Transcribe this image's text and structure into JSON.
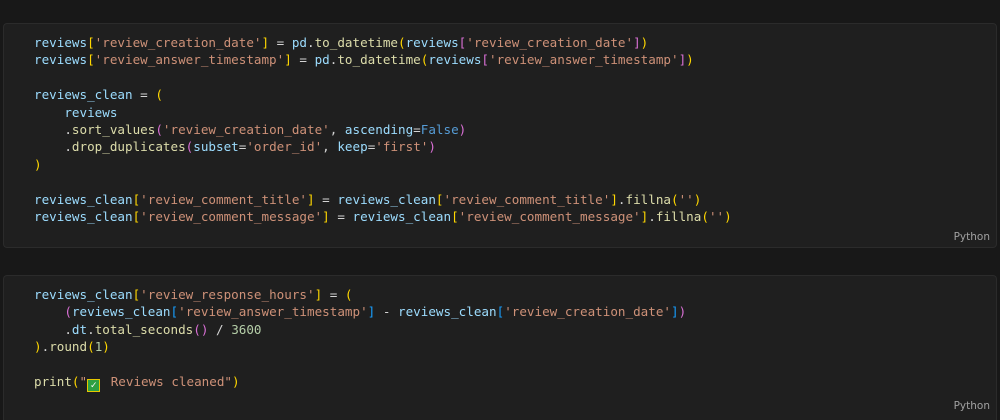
{
  "cells": [
    {
      "language": "Python",
      "lines": [
        [
          [
            "v",
            "reviews"
          ],
          [
            "b1",
            "["
          ],
          [
            "s",
            "'review_creation_date'"
          ],
          [
            "b1",
            "]"
          ],
          [
            "o",
            " = "
          ],
          [
            "v",
            "pd"
          ],
          [
            "o",
            "."
          ],
          [
            "f",
            "to_datetime"
          ],
          [
            "b1",
            "("
          ],
          [
            "v",
            "reviews"
          ],
          [
            "b2",
            "["
          ],
          [
            "s",
            "'review_creation_date'"
          ],
          [
            "b2",
            "]"
          ],
          [
            "b1",
            ")"
          ]
        ],
        [
          [
            "v",
            "reviews"
          ],
          [
            "b1",
            "["
          ],
          [
            "s",
            "'review_answer_timestamp'"
          ],
          [
            "b1",
            "]"
          ],
          [
            "o",
            " = "
          ],
          [
            "v",
            "pd"
          ],
          [
            "o",
            "."
          ],
          [
            "f",
            "to_datetime"
          ],
          [
            "b1",
            "("
          ],
          [
            "v",
            "reviews"
          ],
          [
            "b2",
            "["
          ],
          [
            "s",
            "'review_answer_timestamp'"
          ],
          [
            "b2",
            "]"
          ],
          [
            "b1",
            ")"
          ]
        ],
        [],
        [
          [
            "v",
            "reviews_clean"
          ],
          [
            "o",
            " = "
          ],
          [
            "b1",
            "("
          ]
        ],
        [
          [
            "o",
            "    "
          ],
          [
            "v",
            "reviews"
          ]
        ],
        [
          [
            "o",
            "    ."
          ],
          [
            "f",
            "sort_values"
          ],
          [
            "b2",
            "("
          ],
          [
            "s",
            "'review_creation_date'"
          ],
          [
            "o",
            ", "
          ],
          [
            "v",
            "ascending"
          ],
          [
            "o",
            "="
          ],
          [
            "k",
            "False"
          ],
          [
            "b2",
            ")"
          ]
        ],
        [
          [
            "o",
            "    ."
          ],
          [
            "f",
            "drop_duplicates"
          ],
          [
            "b2",
            "("
          ],
          [
            "v",
            "subset"
          ],
          [
            "o",
            "="
          ],
          [
            "s",
            "'order_id'"
          ],
          [
            "o",
            ", "
          ],
          [
            "v",
            "keep"
          ],
          [
            "o",
            "="
          ],
          [
            "s",
            "'first'"
          ],
          [
            "b2",
            ")"
          ]
        ],
        [
          [
            "b1",
            ")"
          ]
        ],
        [],
        [
          [
            "v",
            "reviews_clean"
          ],
          [
            "b1",
            "["
          ],
          [
            "s",
            "'review_comment_title'"
          ],
          [
            "b1",
            "]"
          ],
          [
            "o",
            " = "
          ],
          [
            "v",
            "reviews_clean"
          ],
          [
            "b1",
            "["
          ],
          [
            "s",
            "'review_comment_title'"
          ],
          [
            "b1",
            "]"
          ],
          [
            "o",
            "."
          ],
          [
            "f",
            "fillna"
          ],
          [
            "b1",
            "("
          ],
          [
            "s",
            "''"
          ],
          [
            "b1",
            ")"
          ]
        ],
        [
          [
            "v",
            "reviews_clean"
          ],
          [
            "b1",
            "["
          ],
          [
            "s",
            "'review_comment_message'"
          ],
          [
            "b1",
            "]"
          ],
          [
            "o",
            " = "
          ],
          [
            "v",
            "reviews_clean"
          ],
          [
            "b1",
            "["
          ],
          [
            "s",
            "'review_comment_message'"
          ],
          [
            "b1",
            "]"
          ],
          [
            "o",
            "."
          ],
          [
            "f",
            "fillna"
          ],
          [
            "b1",
            "("
          ],
          [
            "s",
            "''"
          ],
          [
            "b1",
            ")"
          ]
        ]
      ]
    },
    {
      "language": "Python",
      "lines": [
        [
          [
            "v",
            "reviews_clean"
          ],
          [
            "b1",
            "["
          ],
          [
            "s",
            "'review_response_hours'"
          ],
          [
            "b1",
            "]"
          ],
          [
            "o",
            " = "
          ],
          [
            "b1",
            "("
          ]
        ],
        [
          [
            "o",
            "    "
          ],
          [
            "b2",
            "("
          ],
          [
            "v",
            "reviews_clean"
          ],
          [
            "b3",
            "["
          ],
          [
            "s",
            "'review_answer_timestamp'"
          ],
          [
            "b3",
            "]"
          ],
          [
            "o",
            " - "
          ],
          [
            "v",
            "reviews_clean"
          ],
          [
            "b3",
            "["
          ],
          [
            "s",
            "'review_creation_date'"
          ],
          [
            "b3",
            "]"
          ],
          [
            "b2",
            ")"
          ]
        ],
        [
          [
            "o",
            "    ."
          ],
          [
            "v",
            "dt"
          ],
          [
            "o",
            "."
          ],
          [
            "f",
            "total_seconds"
          ],
          [
            "b2",
            "()"
          ],
          [
            "o",
            " / "
          ],
          [
            "n",
            "3600"
          ]
        ],
        [
          [
            "b1",
            ")"
          ],
          [
            "o",
            "."
          ],
          [
            "f",
            "round"
          ],
          [
            "b1",
            "("
          ],
          [
            "n",
            "1"
          ],
          [
            "b1",
            ")"
          ]
        ],
        [],
        [
          [
            "f",
            "print"
          ],
          [
            "b1",
            "("
          ],
          [
            "s",
            "\""
          ],
          [
            "emoji",
            "check-mark-emoji"
          ],
          [
            "s",
            " Reviews cleaned\""
          ],
          [
            "b1",
            ")"
          ]
        ]
      ]
    }
  ]
}
